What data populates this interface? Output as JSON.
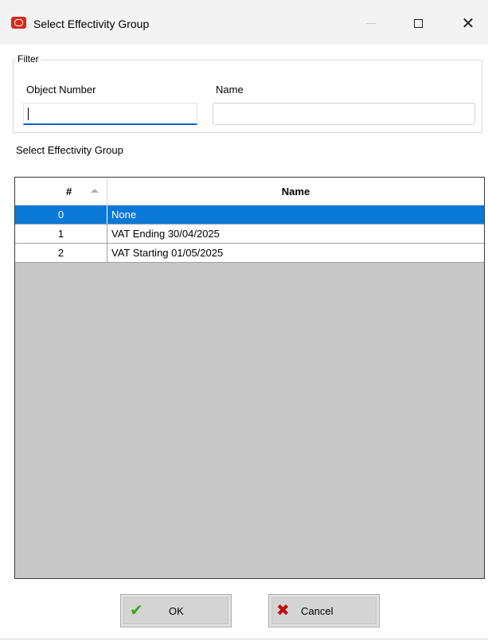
{
  "window": {
    "title": "Select Effectivity Group",
    "app_icon": "oracle-icon",
    "minimize_icon": "minimize-icon",
    "maximize_icon": "maximize-icon",
    "close_icon": "close-icon",
    "close_glyph": "✕"
  },
  "filter": {
    "legend": "Filter",
    "object_number_label": "Object Number",
    "object_number_value": "",
    "name_label": "Name",
    "name_value": ""
  },
  "grid": {
    "caption": "Select Effectivity Group",
    "columns": [
      "#",
      "Name"
    ],
    "sort_icon": "sort-ascending-icon",
    "selected_index": 0,
    "rows": [
      {
        "num": "0",
        "name": "None"
      },
      {
        "num": "1",
        "name": "VAT Ending 30/04/2025"
      },
      {
        "num": "2",
        "name": "VAT Starting 01/05/2025"
      }
    ]
  },
  "buttons": {
    "ok_label": "OK",
    "ok_icon": "checkmark-icon",
    "ok_glyph": "✔",
    "cancel_label": "Cancel",
    "cancel_icon": "cross-icon",
    "cancel_glyph": "✖"
  },
  "colors": {
    "selection": "#0a78d7",
    "focus_underline": "#0067c0",
    "grid_background": "#c8c8c8"
  }
}
